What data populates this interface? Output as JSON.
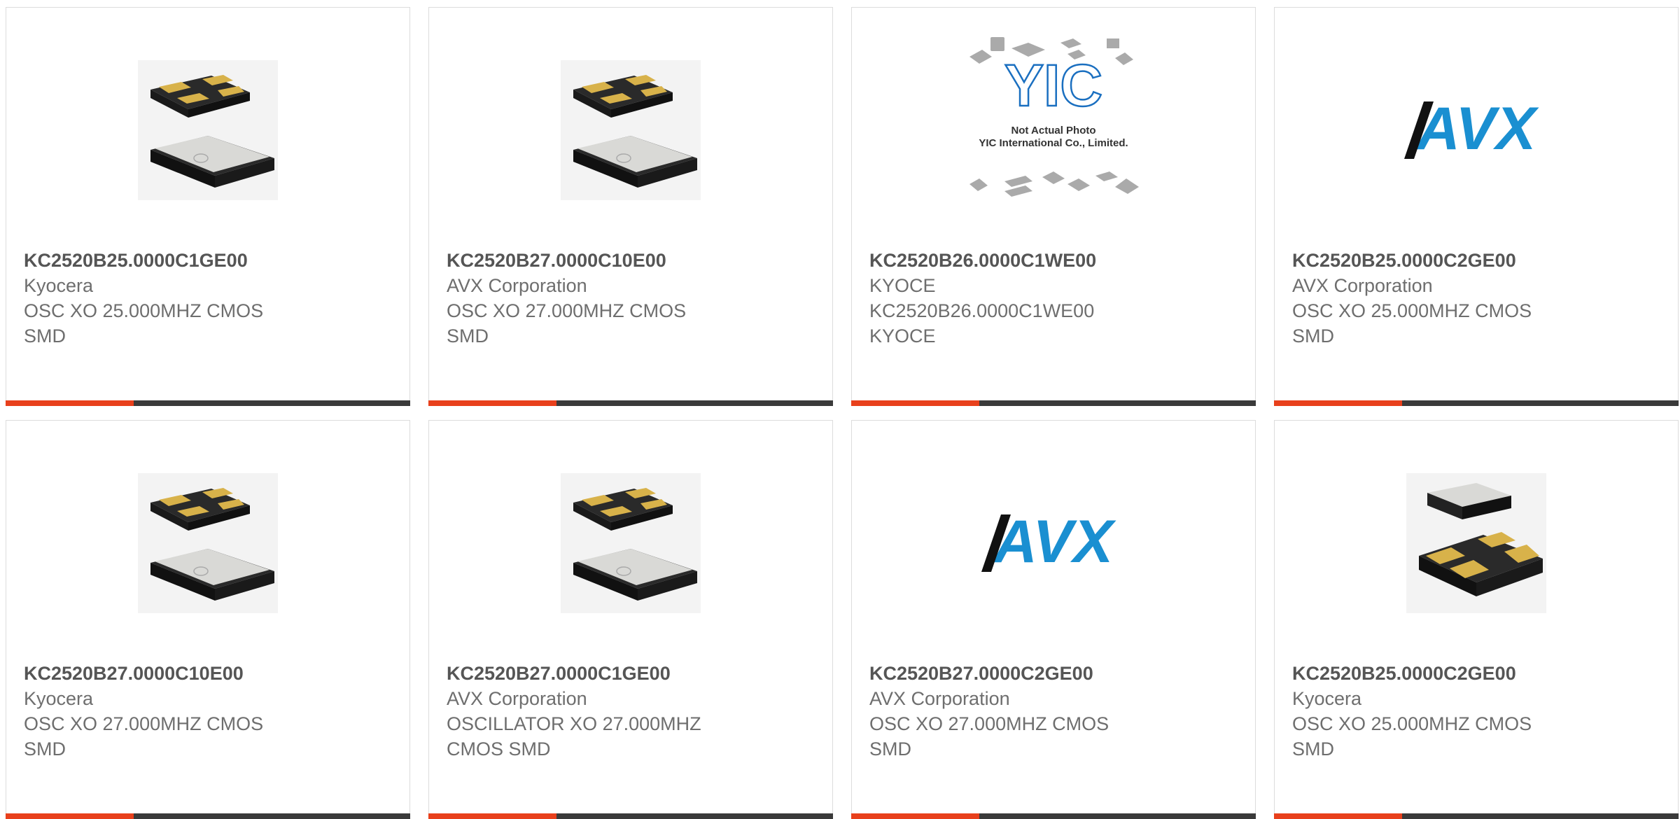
{
  "colors": {
    "accent": "#e8401c",
    "bar": "#3a3a3a",
    "avx_blue": "#1a8fd1",
    "yic_blue": "#1a6fc0"
  },
  "images": {
    "yic": {
      "line1": "Not Actual Photo",
      "line2": "YIC International Co., Limited.",
      "mark": "YIC"
    },
    "avx": {
      "text": "AVX"
    }
  },
  "products": [
    {
      "part": "KC2520B25.0000C1GE00",
      "manufacturer": "Kyocera",
      "description": "OSC XO 25.000MHZ CMOS SMD",
      "image": "crystal-pads-up"
    },
    {
      "part": "KC2520B27.0000C10E00",
      "manufacturer": "AVX Corporation",
      "description": "OSC XO 27.000MHZ CMOS SMD",
      "image": "crystal-pads-up"
    },
    {
      "part": "KC2520B26.0000C1WE00",
      "manufacturer": "KYOCE",
      "description": "KC2520B26.0000C1WE00 KYOCE",
      "image": "yic-placeholder"
    },
    {
      "part": "KC2520B25.0000C2GE00",
      "manufacturer": "AVX Corporation",
      "description": "OSC XO 25.000MHZ CMOS SMD",
      "image": "avx-logo"
    },
    {
      "part": "KC2520B27.0000C10E00",
      "manufacturer": "Kyocera",
      "description": "OSC XO 27.000MHZ CMOS SMD",
      "image": "crystal-pads-up"
    },
    {
      "part": "KC2520B27.0000C1GE00",
      "manufacturer": "AVX Corporation",
      "description": "OSCILLATOR XO 27.000MHZ CMOS SMD",
      "image": "crystal-pads-up"
    },
    {
      "part": "KC2520B27.0000C2GE00",
      "manufacturer": "AVX Corporation",
      "description": "OSC XO 27.000MHZ CMOS SMD",
      "image": "avx-logo"
    },
    {
      "part": "KC2520B25.0000C2GE00",
      "manufacturer": "Kyocera",
      "description": "OSC XO 25.000MHZ CMOS SMD",
      "image": "crystal-pads-down"
    }
  ]
}
